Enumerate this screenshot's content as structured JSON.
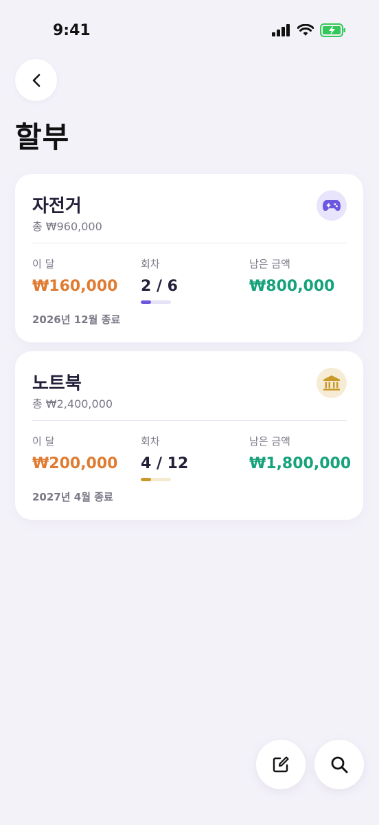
{
  "status_bar": {
    "time": "9:41"
  },
  "page": {
    "title": "할부"
  },
  "installments": [
    {
      "name": "자전거",
      "total": "총 ₩960,000",
      "icon": "gamepad-icon",
      "icon_bg": "#e8e4fb",
      "icon_color": "#6c58e0",
      "this_month_label": "이 달",
      "this_month_value": "₩160,000",
      "count_label": "회차",
      "count_value": "2 / 6",
      "progress": 0.333,
      "progress_color": "#6c58e0",
      "progress_track_color": "#e6e3f8",
      "remaining_label": "남은 금액",
      "remaining_value": "₩800,000",
      "end_text": "2026년 12월 종료"
    },
    {
      "name": "노트북",
      "total": "총 ₩2,400,000",
      "icon": "bank-icon",
      "icon_bg": "#f6ecd6",
      "icon_color": "#c99a2a",
      "this_month_label": "이 달",
      "this_month_value": "₩200,000",
      "count_label": "회차",
      "count_value": "4 / 12",
      "progress": 0.333,
      "progress_color": "#c99a2a",
      "progress_track_color": "#f4ead0",
      "remaining_label": "남은 금액",
      "remaining_value": "₩1,800,000",
      "end_text": "2027년 4월 종료"
    }
  ],
  "fabs": {
    "edit_icon": "edit-icon",
    "search_icon": "search-icon"
  }
}
